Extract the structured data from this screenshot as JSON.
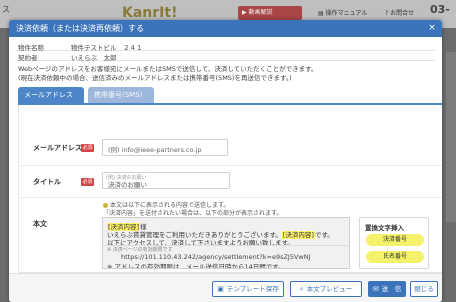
{
  "background": {
    "left_text": "ス",
    "logo_tagline": "",
    "brand": "KanrIt!",
    "youtube_label": "動画解説",
    "manual_label": "操作マニュアル",
    "question_label": "お問合せ",
    "phone_fragment": "03-"
  },
  "modal": {
    "title": "決済依頼（または決済再依頼）する",
    "close_icon": "×",
    "info": [
      {
        "label": "物件名称",
        "value": "物件テストビル　２４１"
      },
      {
        "label": "契約者",
        "value": "いえらぶ　太郎"
      }
    ],
    "description": [
      "Webページのアドレスをお客様宛にメールまたはSMSで送信して、決済していただくことができます。",
      "(現在決済依頼中の場合、送信済みのメールアドレスまたは携帯番号(SMS)を再送信できます。)"
    ],
    "tabs": [
      {
        "label": "メールアドレス",
        "active": true
      },
      {
        "label": "携帯番号(SMS)",
        "active": false
      }
    ],
    "form": {
      "email_label": "メールアドレス",
      "required_label": "必須",
      "email_value": "(例) info@ieee-partners.co.jp",
      "title_label": "タイトル",
      "title_hint": "(例) 決済のお願い",
      "title_value": "決済のお願い",
      "note_line1": "本文は以下に表示される内容で送信します。",
      "note_line2": "「決済内容」を送付されたい場合は、以下の部分が表示されます。",
      "body_label": "本文",
      "body_tag": "[決済内容]",
      "body_line1_suffix": "様",
      "body_line2_prefix": "いえらぶ賃貸管理をご利用いただきありがとうございます。",
      "body_line2_tag": "[決済内容]",
      "body_line2_suffix": "です。",
      "body_line3": "以下にアクセスして、決済して下さいますようお願い致します。",
      "body_small": "※ 決済ページの有効期限です",
      "body_url": "https://101.110.43.242/agency/settlement?k=e9sZJ5VwNJ",
      "body_line5": "※ アドレスの有効期限は、メール送信日時から14日間です。"
    },
    "insert_panel": {
      "title": "置換文字挿入",
      "buttons": [
        "決済番号",
        "氏名番号"
      ]
    },
    "footer": {
      "template_button": "テンプレート保存",
      "preview_button": "本文プレビュー",
      "send_button": "送　信",
      "close_button": "閉じる"
    }
  }
}
